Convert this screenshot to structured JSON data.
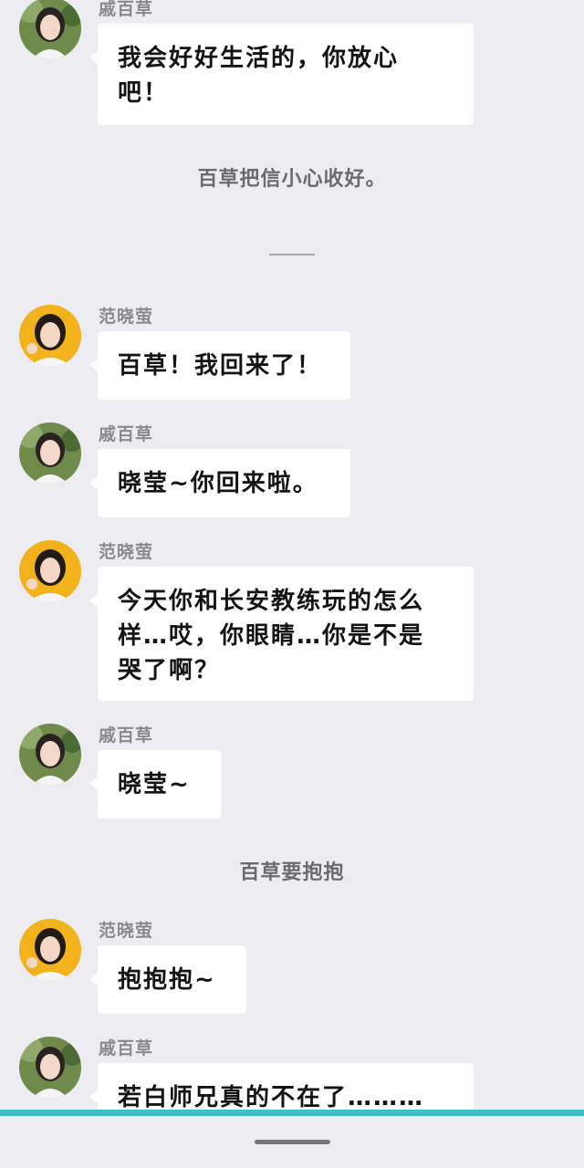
{
  "characters": {
    "qi": {
      "name": "戚百草",
      "avatar_icon": "avatar-qi-baicao",
      "bg": "#5c7a3a"
    },
    "fan": {
      "name": "范晓萤",
      "avatar_icon": "avatar-fan-xiaoying",
      "bg": "#f2b21b"
    }
  },
  "messages": [
    {
      "sender": "戚百草",
      "text": "我会好好生活的，你放心\n吧！"
    },
    {
      "sender": "范晓萤",
      "text": "百草！我回来了！"
    },
    {
      "sender": "戚百草",
      "text": "晓莹~你回来啦。"
    },
    {
      "sender": "范晓萤",
      "text": "今天你和长安教练玩的怎么\n样…哎，你眼睛…你是不是\n哭了啊？"
    },
    {
      "sender": "戚百草",
      "text": "晓莹~"
    },
    {
      "sender": "范晓萤",
      "text": "抱抱抱~"
    },
    {
      "sender": "戚百草",
      "text": "若白师兄真的不在了………"
    }
  ],
  "narrations": [
    "百草把信小心收好。",
    "百草要抱抱"
  ],
  "colors": {
    "background": "#ececf1",
    "bubble": "#ffffff",
    "accent_strip": "#3fbfc6"
  }
}
